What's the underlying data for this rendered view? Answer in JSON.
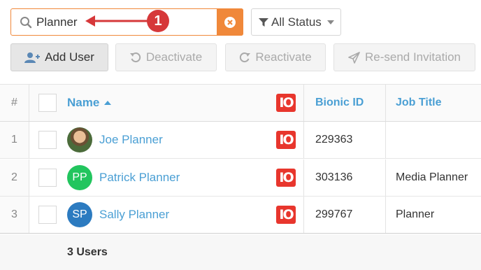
{
  "search": {
    "value": "Planner",
    "annotation_number": "1"
  },
  "status_filter": {
    "label": "All Status"
  },
  "toolbar": {
    "add_user": "Add User",
    "deactivate": "Deactivate",
    "reactivate": "Reactivate",
    "resend": "Re-send Invitation"
  },
  "table": {
    "headers": {
      "num": "#",
      "name": "Name",
      "bionic_id": "Bionic ID",
      "job_title": "Job Title"
    },
    "io_label": "IO",
    "rows": [
      {
        "num": "1",
        "initials": "",
        "name": "Joe Planner",
        "bionic_id": "229363",
        "job_title": ""
      },
      {
        "num": "2",
        "initials": "PP",
        "name": "Patrick Planner",
        "bionic_id": "303136",
        "job_title": "Media Planner"
      },
      {
        "num": "3",
        "initials": "SP",
        "name": "Sally Planner",
        "bionic_id": "299767",
        "job_title": "Planner"
      }
    ]
  },
  "footer": {
    "count": "3 Users"
  },
  "colors": {
    "accent": "#f0883a",
    "link": "#4a9fd4",
    "io_red": "#e8362d",
    "annotation": "#d6383a"
  }
}
